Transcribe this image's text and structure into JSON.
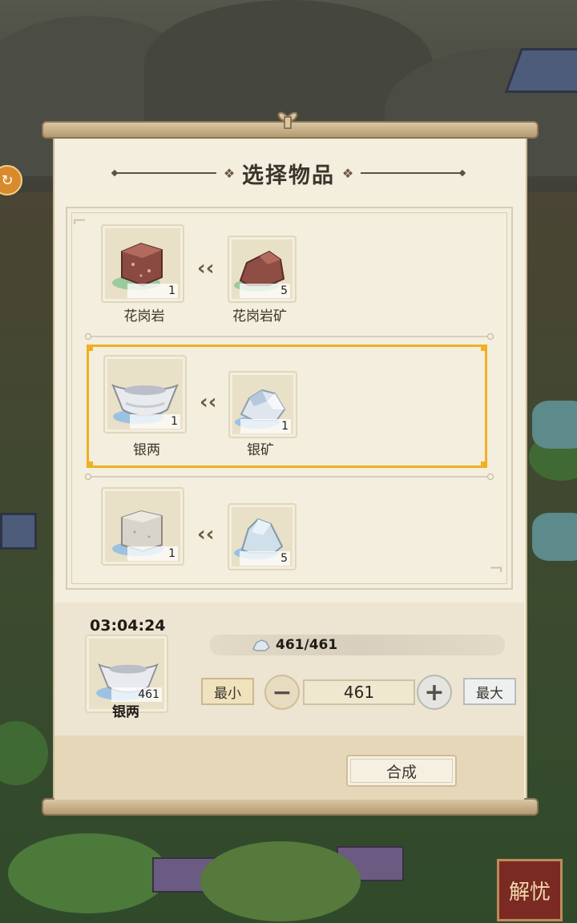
{
  "panel": {
    "title": "选择物品"
  },
  "recipes": [
    {
      "output": {
        "name": "花岗岩",
        "count": "1",
        "icon": "granite-block-icon"
      },
      "input": {
        "name": "花岗岩矿",
        "count": "5",
        "icon": "granite-ore-icon"
      }
    },
    {
      "output": {
        "name": "银两",
        "count": "1",
        "icon": "silver-ingot-icon"
      },
      "input": {
        "name": "银矿",
        "count": "1",
        "icon": "silver-ore-icon"
      },
      "selected": true
    },
    {
      "output": {
        "name": "",
        "count": "1",
        "icon": "marble-block-icon"
      },
      "input": {
        "name": "",
        "count": "5",
        "icon": "marble-ore-icon"
      }
    }
  ],
  "craft": {
    "timer": "03:04:24",
    "output_name": "银两",
    "output_count": "461",
    "stock": "461/461",
    "min_label": "最小",
    "max_label": "最大",
    "quantity": "461",
    "synth_label": "合成"
  },
  "world": {
    "corner_badge": "解忧"
  },
  "colors": {
    "selection": "#f0b021",
    "paper": "#f3eedd"
  }
}
